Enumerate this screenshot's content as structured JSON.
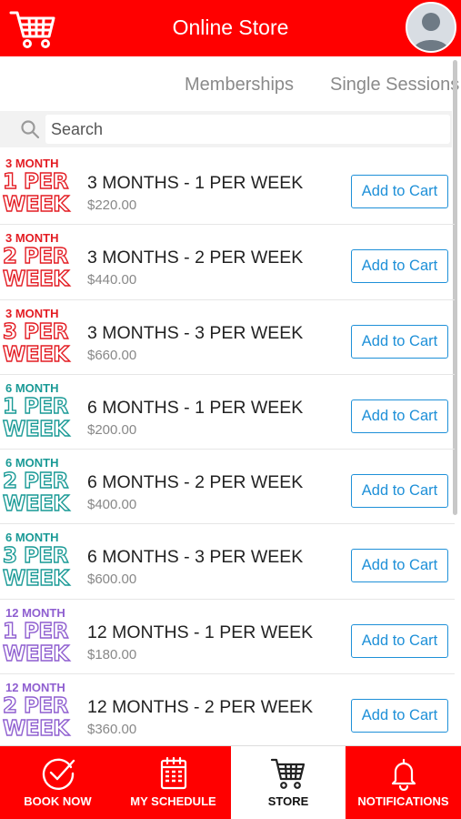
{
  "header": {
    "title": "Online Store"
  },
  "tabs": [
    {
      "label": "Memberships"
    },
    {
      "label": "Single Sessions"
    }
  ],
  "search": {
    "placeholder": "Search"
  },
  "button_label": "Add to Cart",
  "colors": {
    "brand_red": "#ff0000",
    "link_blue": "#1e90d8",
    "three_month": "#e31c23",
    "six_month": "#1a9a96",
    "twelve_month": "#8f5fd0"
  },
  "items": [
    {
      "thumb_duration": "3 MONTH",
      "thumb_line1": "1 PER",
      "thumb_line2": "WEEK",
      "color": "#e31c23",
      "name": "3 MONTHS - 1 PER WEEK",
      "price": "$220.00"
    },
    {
      "thumb_duration": "3 MONTH",
      "thumb_line1": "2 PER",
      "thumb_line2": "WEEK",
      "color": "#e31c23",
      "name": "3 MONTHS - 2 PER WEEK",
      "price": "$440.00"
    },
    {
      "thumb_duration": "3 MONTH",
      "thumb_line1": "3 PER",
      "thumb_line2": "WEEK",
      "color": "#e31c23",
      "name": "3 MONTHS - 3 PER WEEK",
      "price": "$660.00"
    },
    {
      "thumb_duration": "6 MONTH",
      "thumb_line1": "1 PER",
      "thumb_line2": "WEEK",
      "color": "#1a9a96",
      "name": "6 MONTHS - 1 PER WEEK",
      "price": "$200.00"
    },
    {
      "thumb_duration": "6 MONTH",
      "thumb_line1": "2 PER",
      "thumb_line2": "WEEK",
      "color": "#1a9a96",
      "name": "6 MONTHS - 2 PER WEEK",
      "price": "$400.00"
    },
    {
      "thumb_duration": "6 MONTH",
      "thumb_line1": "3 PER",
      "thumb_line2": "WEEK",
      "color": "#1a9a96",
      "name": "6 MONTHS - 3 PER WEEK",
      "price": "$600.00"
    },
    {
      "thumb_duration": "12 MONTH",
      "thumb_line1": "1 PER",
      "thumb_line2": "WEEK",
      "color": "#8f5fd0",
      "name": "12 MONTHS - 1 PER WEEK",
      "price": "$180.00"
    },
    {
      "thumb_duration": "12 MONTH",
      "thumb_line1": "2 PER",
      "thumb_line2": "WEEK",
      "color": "#8f5fd0",
      "name": "12 MONTHS - 2 PER WEEK",
      "price": "$360.00"
    }
  ],
  "bottom_nav": {
    "book": {
      "label": "BOOK NOW",
      "icon": "check-circle-icon"
    },
    "schedule": {
      "label": "MY SCHEDULE",
      "icon": "calendar-icon"
    },
    "store": {
      "label": "STORE",
      "icon": "cart-icon"
    },
    "notifications": {
      "label": "NOTIFICATIONS",
      "icon": "bell-icon"
    }
  }
}
